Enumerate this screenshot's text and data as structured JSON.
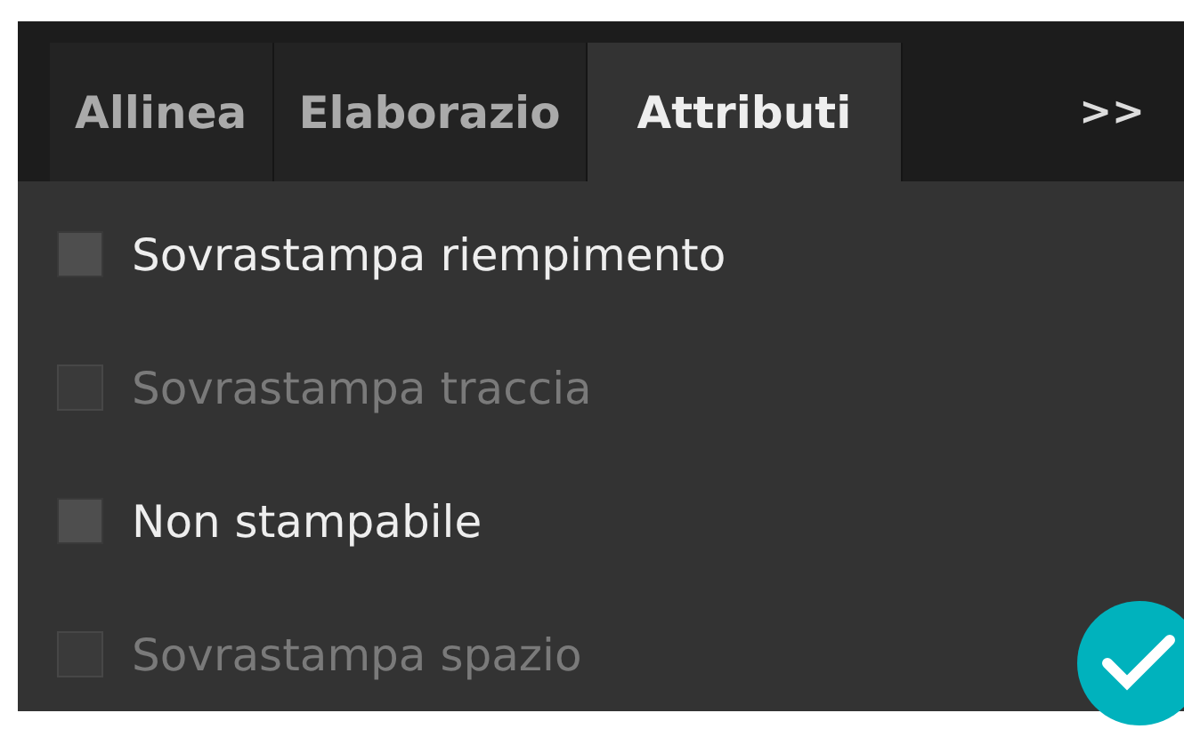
{
  "tabs": [
    {
      "label": "Allinea",
      "selected": false
    },
    {
      "label": "Elaborazio",
      "selected": false
    },
    {
      "label": "Attributi",
      "selected": true
    }
  ],
  "overflow_button": {
    "label": ">>"
  },
  "options": [
    {
      "label": "Sovrastampa riempimento",
      "checked": false,
      "disabled": false
    },
    {
      "label": "Sovrastampa traccia",
      "checked": false,
      "disabled": true
    },
    {
      "label": "Non stampabile",
      "checked": false,
      "disabled": false
    },
    {
      "label": "Sovrastampa spazio",
      "checked": false,
      "disabled": true
    }
  ]
}
